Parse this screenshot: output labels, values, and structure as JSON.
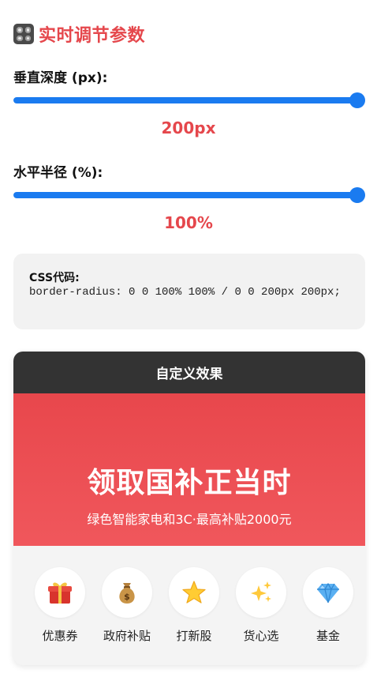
{
  "header": {
    "title": "实时调节参数",
    "icon": "control-knobs-icon"
  },
  "controls": {
    "vertical": {
      "label": "垂直深度 (px):",
      "value_text": "200px",
      "fraction": 1.0
    },
    "horizontal": {
      "label": "水平半径 (%):",
      "value_text": "100%",
      "fraction": 1.0
    }
  },
  "code": {
    "label": "CSS代码:",
    "value": "border-radius: 0 0 100% 100% / 0 0 200px 200px;"
  },
  "preview": {
    "header": "自定义效果",
    "headline": "领取国补正当时",
    "subline": "绿色智能家电和3C·最高补贴2000元",
    "items": [
      {
        "label": "优惠券",
        "icon": "gift-icon"
      },
      {
        "label": "政府补贴",
        "icon": "money-bag-icon"
      },
      {
        "label": "打新股",
        "icon": "star-icon"
      },
      {
        "label": "货心选",
        "icon": "sparkles-icon"
      },
      {
        "label": "基金",
        "icon": "gem-icon"
      }
    ]
  },
  "colors": {
    "accent_red": "#e5474c",
    "slider_blue": "#1a7bf0",
    "card_header_bg": "#333333",
    "banner_red": "#ec4f54"
  }
}
